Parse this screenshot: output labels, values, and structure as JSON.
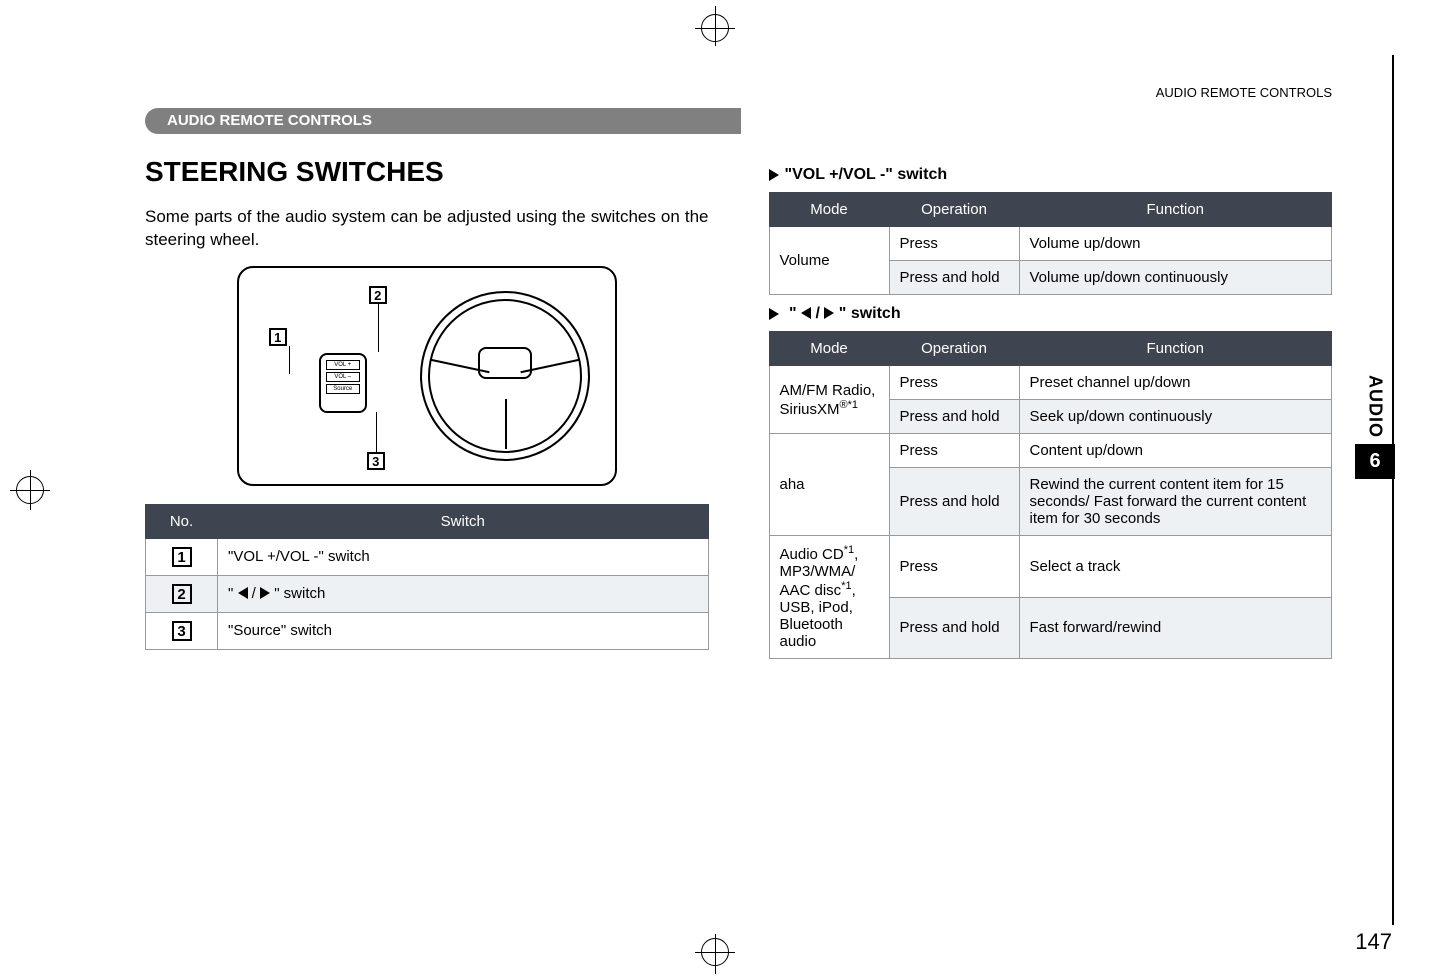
{
  "running_head": "AUDIO REMOTE CONTROLS",
  "section_bar": "AUDIO REMOTE CONTROLS",
  "title": "STEERING SWITCHES",
  "intro": "Some parts of the audio system can be adjusted using the switches on the steering wheel.",
  "ctrl_pad": {
    "vol_up": "VOL +",
    "vol_dn": "VOL –",
    "src": "Source"
  },
  "callouts": {
    "c1": "1",
    "c2": "2",
    "c3": "3"
  },
  "switch_table": {
    "head_no": "No.",
    "head_sw": "Switch",
    "rows": [
      {
        "no": "1",
        "sw": "\"VOL +/VOL -\" switch"
      },
      {
        "no": "2",
        "sw_prefix": "\" ",
        "sw_mid": " / ",
        "sw_suffix": " \" switch"
      },
      {
        "no": "3",
        "sw": "\"Source\" switch"
      }
    ]
  },
  "vol_head": "\"VOL +/VOL -\" switch",
  "vol_table": {
    "h_mode": "Mode",
    "h_op": "Operation",
    "h_fn": "Function",
    "mode": "Volume",
    "r1_op": "Press",
    "r1_fn": "Volume up/down",
    "r2_op": "Press and hold",
    "r2_fn": "Volume up/down continuously"
  },
  "arrow_head_prefix": "\" ",
  "arrow_head_mid": " / ",
  "arrow_head_suffix": " \" switch",
  "arrow_table": {
    "h_mode": "Mode",
    "h_op": "Operation",
    "h_fn": "Function",
    "rows": [
      {
        "mode": "AM/FM Radio, SiriusXM",
        "mode_sup": "®*1",
        "ops": [
          {
            "op": "Press",
            "fn": "Preset channel up/down"
          },
          {
            "op": "Press and hold",
            "fn": "Seek up/down continuously"
          }
        ]
      },
      {
        "mode": "aha",
        "ops": [
          {
            "op": "Press",
            "fn": "Content up/down"
          },
          {
            "op": "Press and hold",
            "fn": "Rewind the current content item for 15 seconds/ Fast forward the current content item for 30 seconds"
          }
        ]
      },
      {
        "mode_rich": true,
        "mode_parts": [
          {
            "t": "Audio CD",
            "sup": "*1"
          },
          {
            "t": ", MP3/WMA/ AAC disc",
            "sup": "*1"
          },
          {
            "t": ", USB, iPod, Bluetooth audio"
          }
        ],
        "ops": [
          {
            "op": "Press",
            "fn": "Select a track"
          },
          {
            "op": "Press and hold",
            "fn": "Fast forward/rewind"
          }
        ]
      }
    ]
  },
  "side_tab": {
    "label": "AUDIO",
    "num": "6"
  },
  "page_num": "147"
}
